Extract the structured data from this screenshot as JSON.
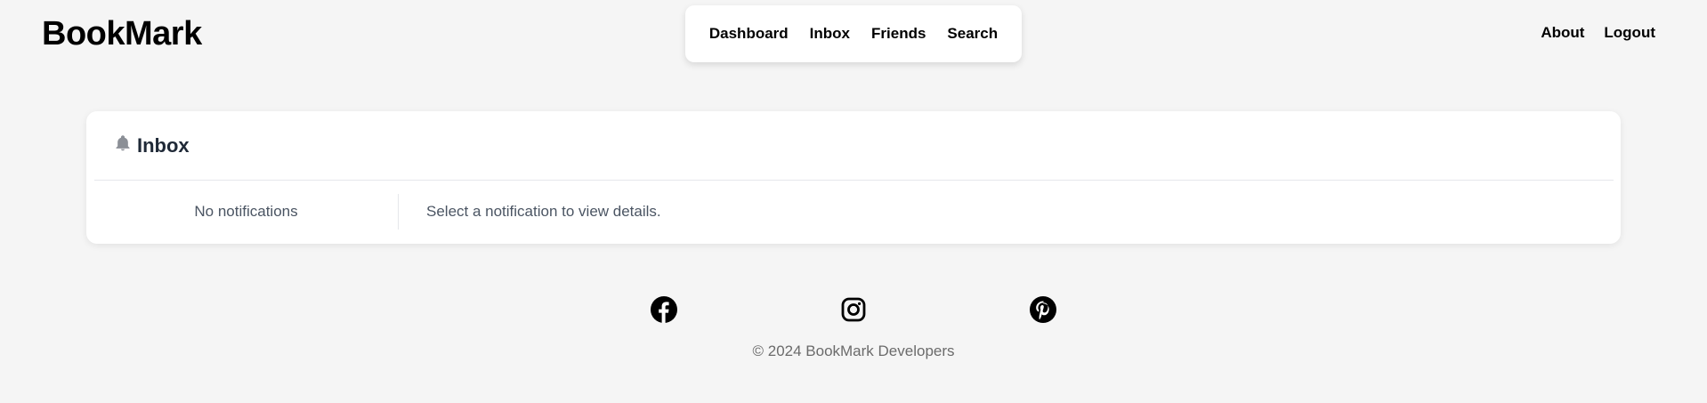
{
  "brand": {
    "name": "BookMark"
  },
  "nav": {
    "center": [
      {
        "label": "Dashboard"
      },
      {
        "label": "Inbox"
      },
      {
        "label": "Friends"
      },
      {
        "label": "Search"
      }
    ],
    "right": [
      {
        "label": "About"
      },
      {
        "label": "Logout"
      }
    ]
  },
  "inbox": {
    "icon": "bell-icon",
    "title": "Inbox",
    "empty_text": "No notifications",
    "detail_placeholder": "Select a notification to view details."
  },
  "footer": {
    "social": [
      {
        "icon": "facebook-icon"
      },
      {
        "icon": "instagram-icon"
      },
      {
        "icon": "pinterest-icon"
      }
    ],
    "copyright": "© 2024 BookMark Developers"
  },
  "colors": {
    "background": "#f5f5f5",
    "card": "#ffffff",
    "text_primary": "#000000",
    "text_muted": "#6b6b6b",
    "icon_gray": "#8b8f96"
  }
}
